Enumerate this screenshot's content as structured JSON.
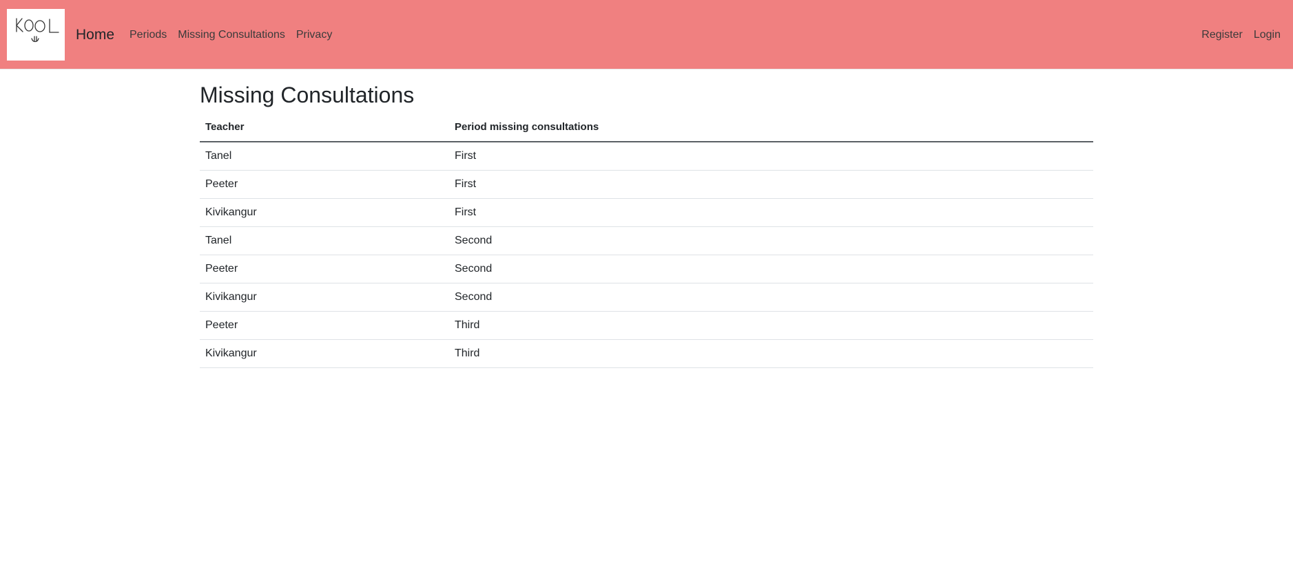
{
  "navbar": {
    "logo_text": "KOOL",
    "brand": "Home",
    "links": [
      {
        "label": "Periods"
      },
      {
        "label": "Missing Consultations"
      },
      {
        "label": "Privacy"
      }
    ],
    "right_links": [
      {
        "label": "Register"
      },
      {
        "label": "Login"
      }
    ],
    "background_color": "#f08080"
  },
  "main": {
    "title": "Missing Consultations",
    "table": {
      "headers": [
        "Teacher",
        "Period missing consultations"
      ],
      "rows": [
        {
          "teacher": "Tanel",
          "period": "First"
        },
        {
          "teacher": "Peeter",
          "period": "First"
        },
        {
          "teacher": "Kivikangur",
          "period": "First"
        },
        {
          "teacher": "Tanel",
          "period": "Second"
        },
        {
          "teacher": "Peeter",
          "period": "Second"
        },
        {
          "teacher": "Kivikangur",
          "period": "Second"
        },
        {
          "teacher": "Peeter",
          "period": "Third"
        },
        {
          "teacher": "Kivikangur",
          "period": "Third"
        }
      ]
    }
  }
}
